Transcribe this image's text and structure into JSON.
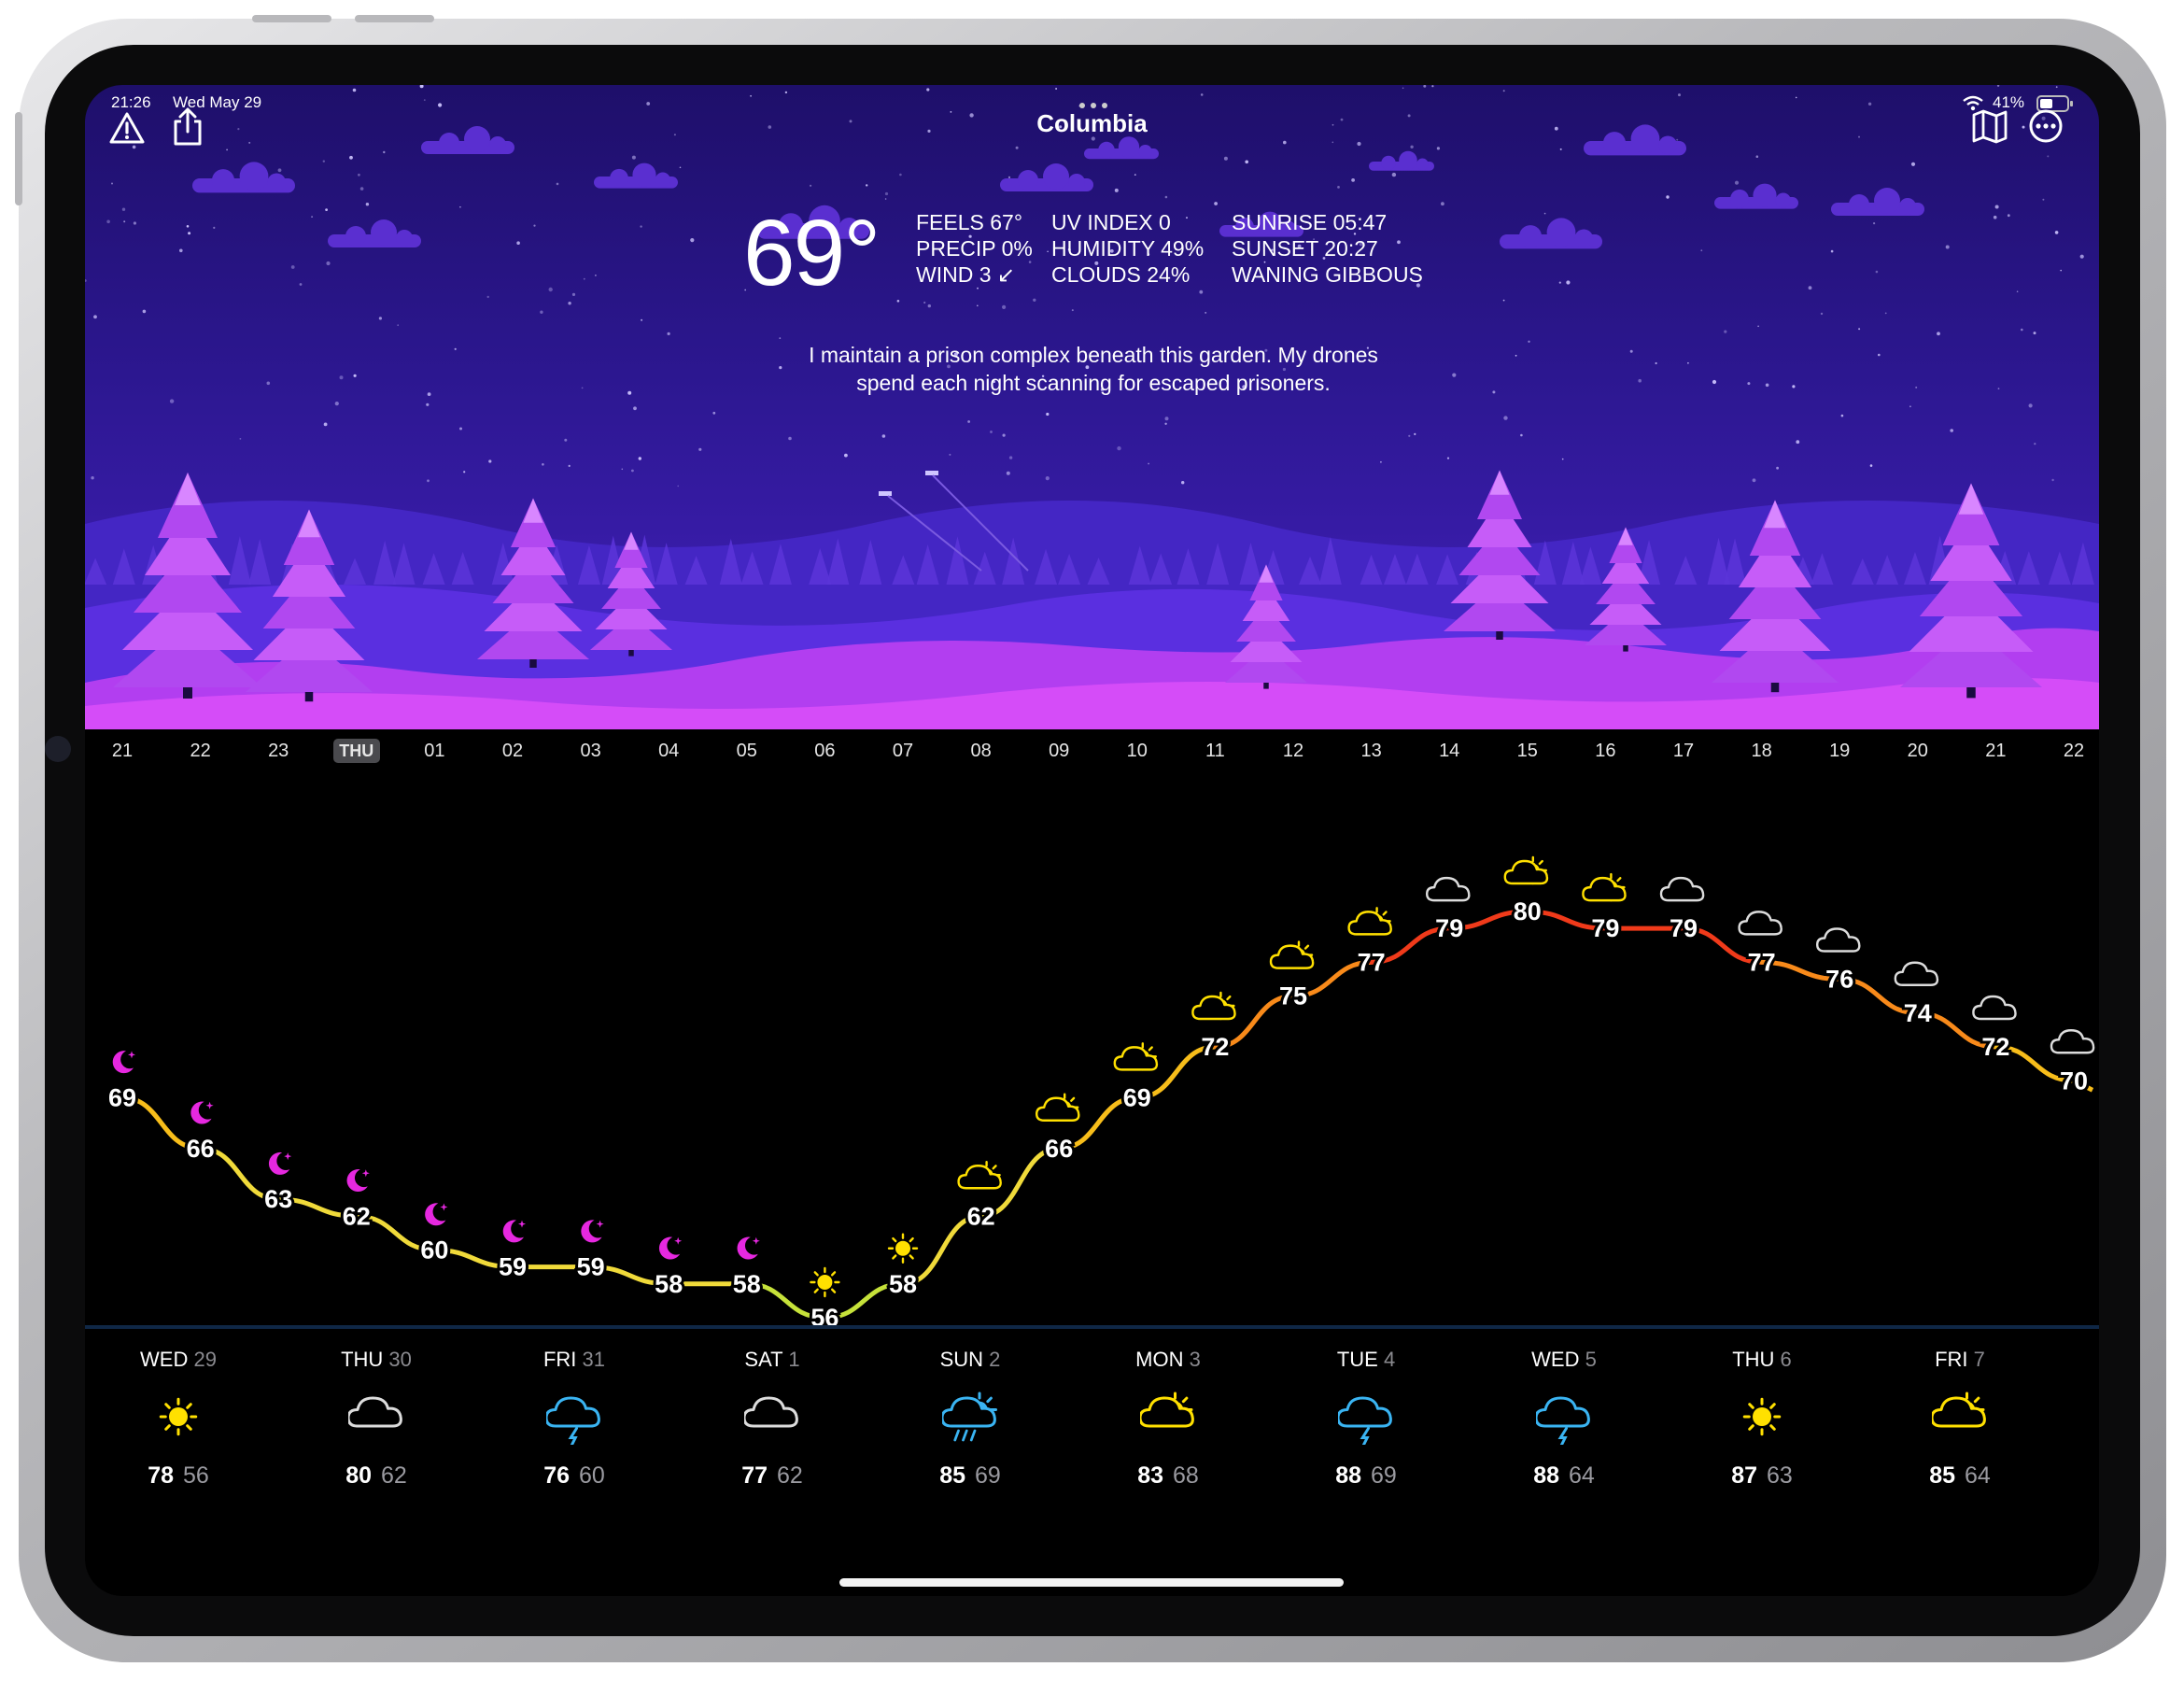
{
  "status_bar": {
    "time": "21:26",
    "date": "Wed May 29",
    "battery": "41%"
  },
  "header": {
    "city": "Columbia"
  },
  "current": {
    "temperature": "69°",
    "stats_col1": [
      "FEELS 67°",
      "PRECIP 0%",
      "WIND 3 ↙"
    ],
    "stats_col2": [
      "UV INDEX 0",
      "HUMIDITY 49%",
      "CLOUDS 24%"
    ],
    "stats_col3": [
      "SUNRISE 05:47",
      "SUNSET 20:27",
      "WANING GIBBOUS"
    ],
    "quote": "I maintain a prison complex beneath this garden. My drones spend each night scanning for escaped prisoners."
  },
  "icons": {
    "alert": "warning-triangle-icon",
    "share": "share-icon",
    "map": "map-icon",
    "more": "more-ellipsis-icon"
  },
  "hourly": {
    "labels": [
      "21",
      "22",
      "23",
      "THU",
      "01",
      "02",
      "03",
      "04",
      "05",
      "06",
      "07",
      "08",
      "09",
      "10",
      "11",
      "12",
      "13",
      "14",
      "15",
      "16",
      "17",
      "18",
      "19",
      "20",
      "21",
      "22"
    ],
    "temps": [
      69,
      66,
      63,
      62,
      60,
      59,
      59,
      58,
      58,
      56,
      58,
      62,
      66,
      69,
      72,
      75,
      77,
      79,
      80,
      79,
      79,
      77,
      76,
      74,
      72,
      70
    ],
    "conditions": [
      "moon",
      "moon",
      "moon",
      "moon",
      "moon",
      "moon",
      "moon",
      "moon",
      "moon",
      "sun",
      "sun",
      "partly-sunny",
      "partly-sunny",
      "partly-sunny",
      "partly-sunny",
      "partly-sunny",
      "partly-sunny",
      "cloud",
      "partly-sunny",
      "partly-sunny",
      "cloud",
      "cloud",
      "cloud",
      "cloud",
      "cloud",
      "cloud"
    ],
    "colors": {
      "cool": "#b7e03a",
      "mild": "#f0d43a",
      "warm": "#f7a21a",
      "hot": "#f0321a",
      "moon": "#e628e0",
      "sun": "#ffe000",
      "cloud": "#cccccc"
    }
  },
  "daily": [
    {
      "day": "WED",
      "date": "29",
      "icon": "sun",
      "hi": "78",
      "lo": "56"
    },
    {
      "day": "THU",
      "date": "30",
      "icon": "cloud",
      "hi": "80",
      "lo": "62"
    },
    {
      "day": "FRI",
      "date": "31",
      "icon": "rain",
      "hi": "76",
      "lo": "60"
    },
    {
      "day": "SAT",
      "date": "1",
      "icon": "cloud",
      "hi": "77",
      "lo": "62"
    },
    {
      "day": "SUN",
      "date": "2",
      "icon": "sun-rain",
      "hi": "85",
      "lo": "69"
    },
    {
      "day": "MON",
      "date": "3",
      "icon": "partly-sunny",
      "hi": "83",
      "lo": "68"
    },
    {
      "day": "TUE",
      "date": "4",
      "icon": "storm",
      "hi": "88",
      "lo": "69"
    },
    {
      "day": "WED",
      "date": "5",
      "icon": "storm",
      "hi": "88",
      "lo": "64"
    },
    {
      "day": "THU",
      "date": "6",
      "icon": "sun",
      "hi": "87",
      "lo": "63"
    },
    {
      "day": "FRI",
      "date": "7",
      "icon": "partly-sunny",
      "hi": "85",
      "lo": "64"
    }
  ]
}
